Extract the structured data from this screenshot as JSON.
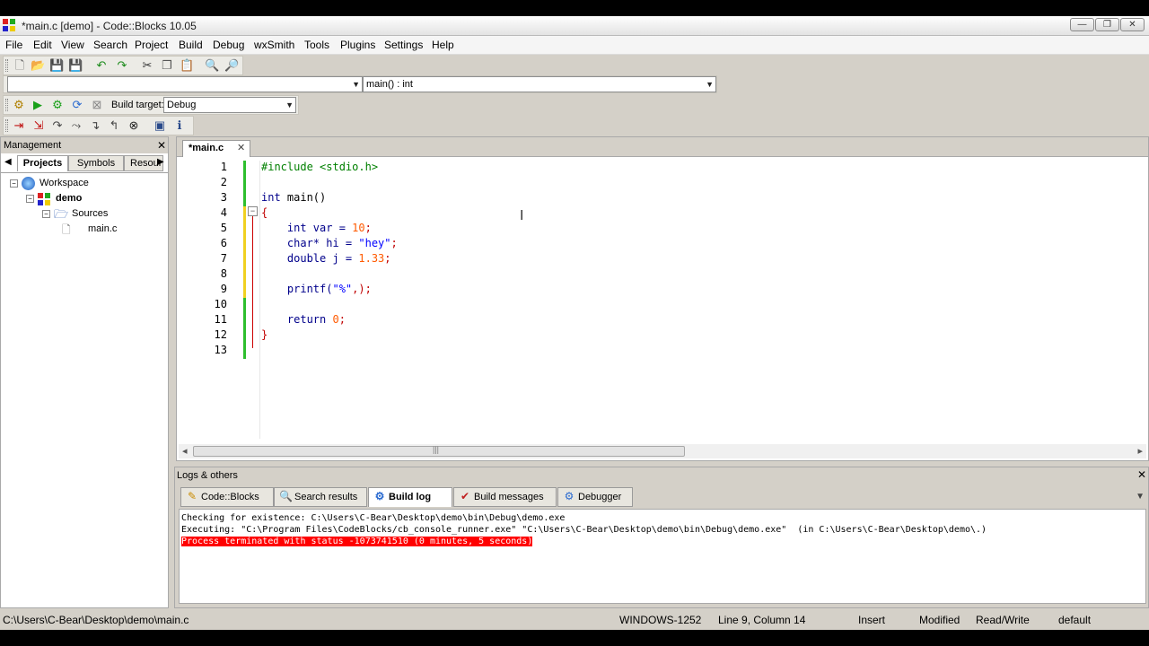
{
  "window": {
    "title": "*main.c [demo] - Code::Blocks 10.05",
    "controls": [
      "—",
      "❐",
      "✕"
    ]
  },
  "menu": [
    "File",
    "Edit",
    "View",
    "Search",
    "Project",
    "Build",
    "Debug",
    "wxSmith",
    "Tools",
    "Plugins",
    "Settings",
    "Help"
  ],
  "toolbar": {
    "scope_combo": "",
    "function_combo": "main() : int",
    "build_target_label": "Build target:",
    "build_target_value": "Debug"
  },
  "management": {
    "title": "Management",
    "close": "✕",
    "tabs": [
      "Projects",
      "Symbols",
      "Resour"
    ],
    "tree": {
      "workspace": "Workspace",
      "project": "demo",
      "folder": "Sources",
      "file": "main.c"
    }
  },
  "editor": {
    "tab_label": "*main.c",
    "close": "✕",
    "line_numbers": [
      "1",
      "2",
      "3",
      "4",
      "5",
      "6",
      "7",
      "8",
      "9",
      "10",
      "11",
      "12",
      "13"
    ],
    "fold_marker": "⊟",
    "code": {
      "line1": "#include <stdio.h>",
      "line3_kw": "int",
      "line3_rest": " main()",
      "line4": "{",
      "line5_a": "    int var = ",
      "line5_num": "10",
      "line5_end": ";",
      "line6_a": "    char* hi = ",
      "line6_str": "\"hey\"",
      "line6_end": ";",
      "line7_a": "    double j = ",
      "line7_num": "1.33",
      "line7_end": ";",
      "line9_a": "    printf(",
      "line9_str": "\"%\"",
      "line9_end": ",);",
      "line11_a": "    return ",
      "line11_num": "0",
      "line11_end": ";",
      "line12": "}"
    },
    "scroll_left": "◂",
    "scroll_right": "▸",
    "scroll_grip": "|||"
  },
  "logs": {
    "title": "Logs & others",
    "close": "✕",
    "tabs": [
      "Code::Blocks",
      "Search results",
      "Build log",
      "Build messages",
      "Debugger"
    ],
    "tab_icons": [
      "✎",
      "🔍",
      "⚙",
      "✔",
      "⚙"
    ],
    "active_tab": "Build log",
    "lines": [
      "Checking for existence: C:\\Users\\C-Bear\\Desktop\\demo\\bin\\Debug\\demo.exe",
      "Executing: \"C:\\Program Files\\CodeBlocks/cb_console_runner.exe\" \"C:\\Users\\C-Bear\\Desktop\\demo\\bin\\Debug\\demo.exe\"  (in C:\\Users\\C-Bear\\Desktop\\demo\\.)",
      "Process terminated with status -1073741510 (0 minutes, 5 seconds)"
    ]
  },
  "status": {
    "path": "C:\\Users\\C-Bear\\Desktop\\demo\\main.c",
    "encoding": "WINDOWS-1252",
    "position": "Line 9, Column 14",
    "mode": "Insert",
    "modified": "Modified",
    "access": "Read/Write",
    "profile": "default"
  },
  "colors": {
    "added_line": "#2dbe2d",
    "modified_line": "#f0d020",
    "error_highlight": "#ff0000"
  }
}
